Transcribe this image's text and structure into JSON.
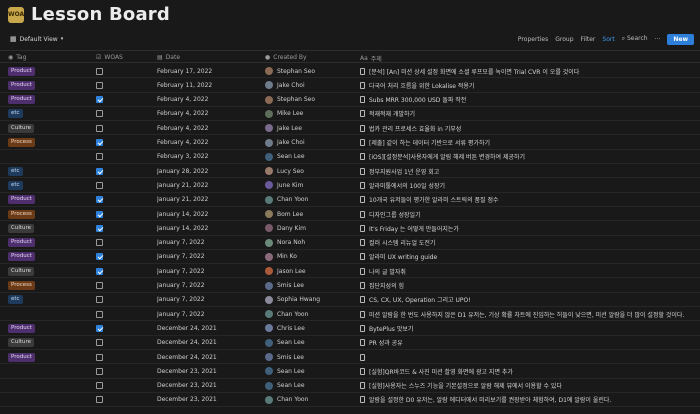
{
  "app": {
    "title": "Lesson Board",
    "logo_text": "WOA"
  },
  "toolbar": {
    "view_label": "Default View",
    "properties": "Properties",
    "group": "Group",
    "filter": "Filter",
    "sort": "Sort",
    "search": "Search",
    "more": "···",
    "new": "New"
  },
  "columns": {
    "tag": "Tag",
    "woas": "WOAS",
    "date": "Date",
    "created_by": "Created By",
    "topic": "주제"
  },
  "rows": [
    {
      "tag": "Product",
      "woas": false,
      "date": "February 17, 2022",
      "user": "Stephan Seo",
      "topic": "[분석] [An] 미션 상세 설정 화면에 소셜 루프모를 녹이면 Trial CVR 이 오를 것이다"
    },
    {
      "tag": "Product",
      "woas": false,
      "date": "February 11, 2022",
      "user": "Jake Choi",
      "topic": "다국어 처리 흐름을 위한 Lokalise 적용기"
    },
    {
      "tag": "Product",
      "woas": true,
      "date": "February 4, 2022",
      "user": "Stephan Seo",
      "topic": "Subs MRR 300,000 USD 돌파 작전"
    },
    {
      "tag": "etc",
      "woas": false,
      "date": "February 4, 2022",
      "user": "Mike Lee",
      "topic": "적재적재 개발하기"
    },
    {
      "tag": "Culture",
      "woas": false,
      "date": "February 4, 2022",
      "user": "Jake Lee",
      "topic": "법카 관리 프로세스 효율화 in 기부성"
    },
    {
      "tag": "Process",
      "woas": true,
      "date": "February 4, 2022",
      "user": "Jake Choi",
      "topic": "[제출] 같이 하는 데이터 기반으로 서류 평가하기"
    },
    {
      "tag": "",
      "woas": false,
      "date": "February 3, 2022",
      "user": "Sean Lee",
      "topic": "[iOS][설정분석]사용자에게 알림 해제 버튼 변경하여 제공하기"
    },
    {
      "tag": "etc",
      "woas": true,
      "date": "January 28, 2022",
      "user": "Lucy Seo",
      "topic": "정부지원사업 1년 운영 회고"
    },
    {
      "tag": "etc",
      "woas": false,
      "date": "January 21, 2022",
      "user": "June Kim",
      "topic": "알라미툴에서의 100일 성장기"
    },
    {
      "tag": "Product",
      "woas": true,
      "date": "January 21, 2022",
      "user": "Chan Yoon",
      "topic": "10개국 유저들이 평가한 알라미 스트릭의 품질 점수"
    },
    {
      "tag": "Process",
      "woas": true,
      "date": "January 14, 2022",
      "user": "Bom Lee",
      "topic": "디자인그룹 성장일기"
    },
    {
      "tag": "Culture",
      "woas": true,
      "date": "January 14, 2022",
      "user": "Dany Kim",
      "topic": "It's Friday 는 어떻게 만들어지는가"
    },
    {
      "tag": "Product",
      "woas": false,
      "date": "January 7, 2022",
      "user": "Nora Noh",
      "topic": "컬러 시스템 리뉴얼 도전기"
    },
    {
      "tag": "Product",
      "woas": true,
      "date": "January 7, 2022",
      "user": "Min Ko",
      "topic": "알라미 UX writing guide"
    },
    {
      "tag": "Culture",
      "woas": true,
      "date": "January 7, 2022",
      "user": "Jason Lee",
      "topic": "나의 글 발자취"
    },
    {
      "tag": "Process",
      "woas": false,
      "date": "January 7, 2022",
      "user": "Smis Lee",
      "topic": "집단지성의 힘"
    },
    {
      "tag": "etc",
      "woas": false,
      "date": "January 7, 2022",
      "user": "Sophia Hwang",
      "topic": "CS, CX, UX, Operation 그리고 UPO!"
    },
    {
      "tag": "",
      "woas": false,
      "date": "January 7, 2022",
      "user": "Chan Yoon",
      "topic": "미션 알람을 한 번도 사용하지 않은 D1 유저는, 기상 확률 차트에 진입하는 허들이 낮으면, 미션 알람을 더 많이 설정할 것이다."
    },
    {
      "tag": "Product",
      "woas": true,
      "date": "December 24, 2021",
      "user": "Chris Lee",
      "topic": "BytePlus 맛보기"
    },
    {
      "tag": "Culture",
      "woas": false,
      "date": "December 24, 2021",
      "user": "Sean Lee",
      "topic": "PR 성과 공유"
    },
    {
      "tag": "Product",
      "woas": false,
      "date": "December 24, 2021",
      "user": "Smis Lee",
      "topic": ""
    },
    {
      "tag": "",
      "woas": false,
      "date": "December 23, 2021",
      "user": "Sean Lee",
      "topic": "[실험]QR바코드 & 사진 미션 촬영 화면에 광고 지면 추가"
    },
    {
      "tag": "",
      "woas": false,
      "date": "December 23, 2021",
      "user": "Sean Lee",
      "topic": "[실험]사용자는 스누즈 기능을 기본설정으로 알람 해제 뷰에서 이용할 수 있다"
    },
    {
      "tag": "",
      "woas": false,
      "date": "December 23, 2021",
      "user": "Chan Yoon",
      "topic": "알람을 설정한 D0 유저는, 알람 에디터에서 미리보기를 권장받아 체험하여, D1에 알람이 울린다."
    }
  ],
  "colors": {
    "Stephan Seo": "#8a6a55",
    "Jake Choi": "#6f7c8c",
    "Mike Lee": "#5d6e5a",
    "Jake Lee": "#7a6a8c",
    "Sean Lee": "#3f5f7a",
    "Lucy Seo": "#9a7a6a",
    "June Kim": "#6a5a9a",
    "Chan Yoon": "#5a7a7a",
    "Bom Lee": "#8a7a5a",
    "Dany Kim": "#7a5a6a",
    "Nora Noh": "#6a8a7a",
    "Min Ko": "#8a6a7a",
    "Jason Lee": "#aa5a3a",
    "Smis Lee": "#5a6a8a",
    "Sophia Hwang": "#8a8a9a",
    "Chris Lee": "#6a7a9a"
  }
}
